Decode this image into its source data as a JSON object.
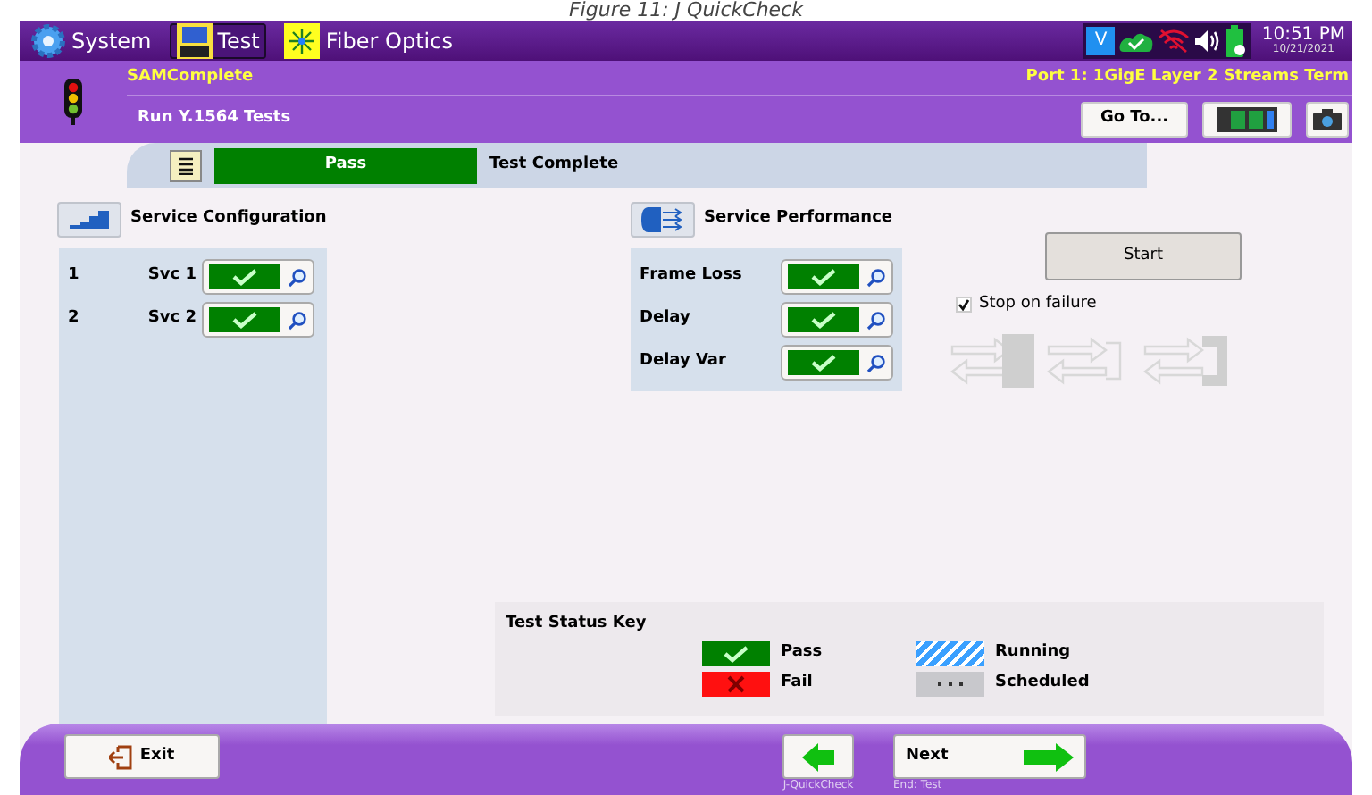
{
  "caption": "Figure 11: J QuickCheck",
  "top_tabs": [
    {
      "label": "System",
      "selected": false,
      "kind": "gear"
    },
    {
      "label": "Test",
      "selected": true,
      "kind": "bert"
    },
    {
      "label": "Fiber Optics",
      "selected": false,
      "kind": "fiber"
    }
  ],
  "status_bar": {
    "vnc": "V",
    "time": "10:51 PM",
    "date": "10/21/2021"
  },
  "header": {
    "app": "SAMComplete",
    "subtitle": "Run Y.1564 Tests",
    "port": "Port 1: 1GigE Layer 2 Streams Term",
    "goto": "Go To..."
  },
  "progress": {
    "passed": true,
    "label": "Pass",
    "message": "Test Complete"
  },
  "service_configuration": {
    "title": "Service Configuration",
    "rows": [
      {
        "index": "1",
        "name": "Svc 1",
        "passed": true
      },
      {
        "index": "2",
        "name": "Svc 2",
        "passed": true
      }
    ]
  },
  "service_performance": {
    "title": "Service Performance",
    "rows": [
      {
        "name": "Frame Loss",
        "passed": true
      },
      {
        "name": "Delay",
        "passed": true
      },
      {
        "name": "Delay Var",
        "passed": true
      }
    ]
  },
  "start_button": "Start",
  "stop_on_failure": {
    "label": "Stop on failure",
    "checked": true
  },
  "status_key": {
    "title": "Test Status Key",
    "items": [
      {
        "kind": "pass",
        "label": "Pass"
      },
      {
        "kind": "running",
        "label": "Running"
      },
      {
        "kind": "fail",
        "label": "Fail"
      },
      {
        "kind": "scheduled",
        "label": "Scheduled"
      }
    ]
  },
  "footer": {
    "exit": "Exit",
    "back_caption": "J-QuickCheck",
    "next": "Next",
    "next_caption": "End: Test"
  }
}
